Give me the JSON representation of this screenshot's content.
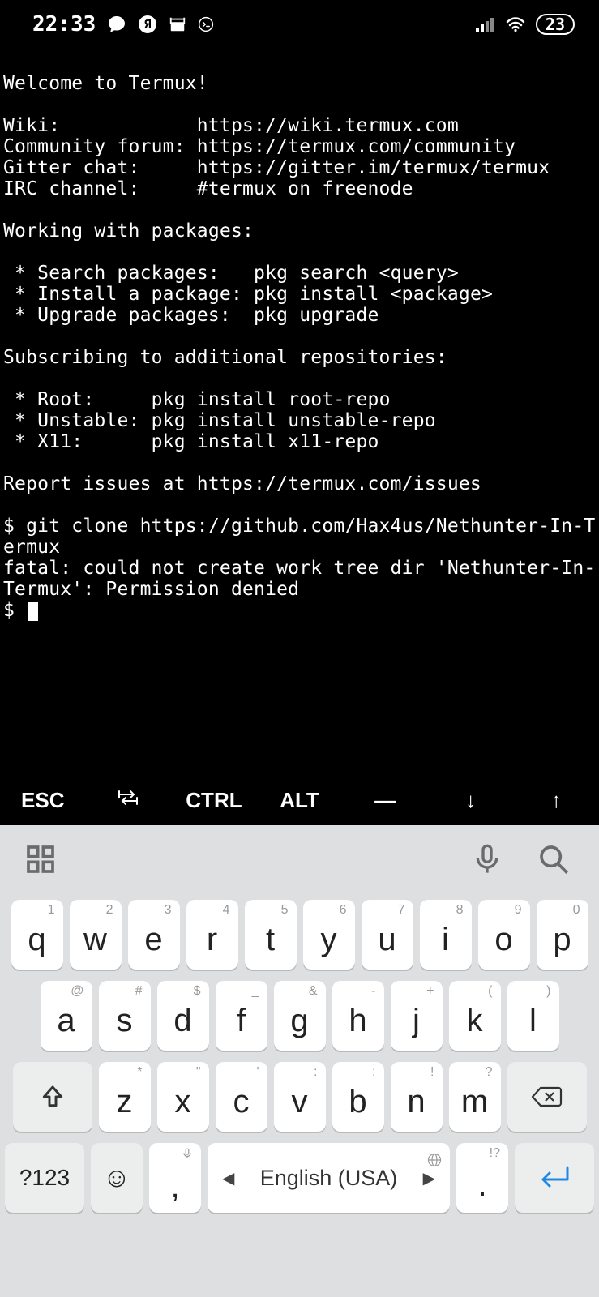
{
  "status": {
    "time": "22:33",
    "battery_pct": "23"
  },
  "terminal": {
    "text": "Welcome to Termux!\n\nWiki:            https://wiki.termux.com\nCommunity forum: https://termux.com/community\nGitter chat:     https://gitter.im/termux/termux\nIRC channel:     #termux on freenode\n\nWorking with packages:\n\n * Search packages:   pkg search <query>\n * Install a package: pkg install <package>\n * Upgrade packages:  pkg upgrade\n\nSubscribing to additional repositories:\n\n * Root:     pkg install root-repo\n * Unstable: pkg install unstable-repo\n * X11:      pkg install x11-repo\n\nReport issues at https://termux.com/issues\n\n$ git clone https://github.com/Hax4us/Nethunter-In-Termux\nfatal: could not create work tree dir 'Nethunter-In-Termux': Permission denied\n$ "
  },
  "extra_keys": {
    "esc": "ESC",
    "tab": "⇥",
    "ctrl": "CTRL",
    "alt": "ALT",
    "dash": "—",
    "down": "↓",
    "up": "↑"
  },
  "keyboard": {
    "row1": [
      {
        "main": "q",
        "sub": "1"
      },
      {
        "main": "w",
        "sub": "2"
      },
      {
        "main": "e",
        "sub": "3"
      },
      {
        "main": "r",
        "sub": "4"
      },
      {
        "main": "t",
        "sub": "5"
      },
      {
        "main": "y",
        "sub": "6"
      },
      {
        "main": "u",
        "sub": "7"
      },
      {
        "main": "i",
        "sub": "8"
      },
      {
        "main": "o",
        "sub": "9"
      },
      {
        "main": "p",
        "sub": "0"
      }
    ],
    "row2": [
      {
        "main": "a",
        "sub": "@"
      },
      {
        "main": "s",
        "sub": "#"
      },
      {
        "main": "d",
        "sub": "$"
      },
      {
        "main": "f",
        "sub": "_"
      },
      {
        "main": "g",
        "sub": "&"
      },
      {
        "main": "h",
        "sub": "-"
      },
      {
        "main": "j",
        "sub": "+"
      },
      {
        "main": "k",
        "sub": "("
      },
      {
        "main": "l",
        "sub": ")"
      }
    ],
    "row3": [
      {
        "main": "z",
        "sub": "*"
      },
      {
        "main": "x",
        "sub": "\""
      },
      {
        "main": "c",
        "sub": "'"
      },
      {
        "main": "v",
        "sub": ":"
      },
      {
        "main": "b",
        "sub": ";"
      },
      {
        "main": "n",
        "sub": "!"
      },
      {
        "main": "m",
        "sub": "?"
      }
    ],
    "row4": {
      "numsym": "?123",
      "comma": ",",
      "space": "English (USA)",
      "period": ".",
      "period_sub": "!?"
    }
  }
}
